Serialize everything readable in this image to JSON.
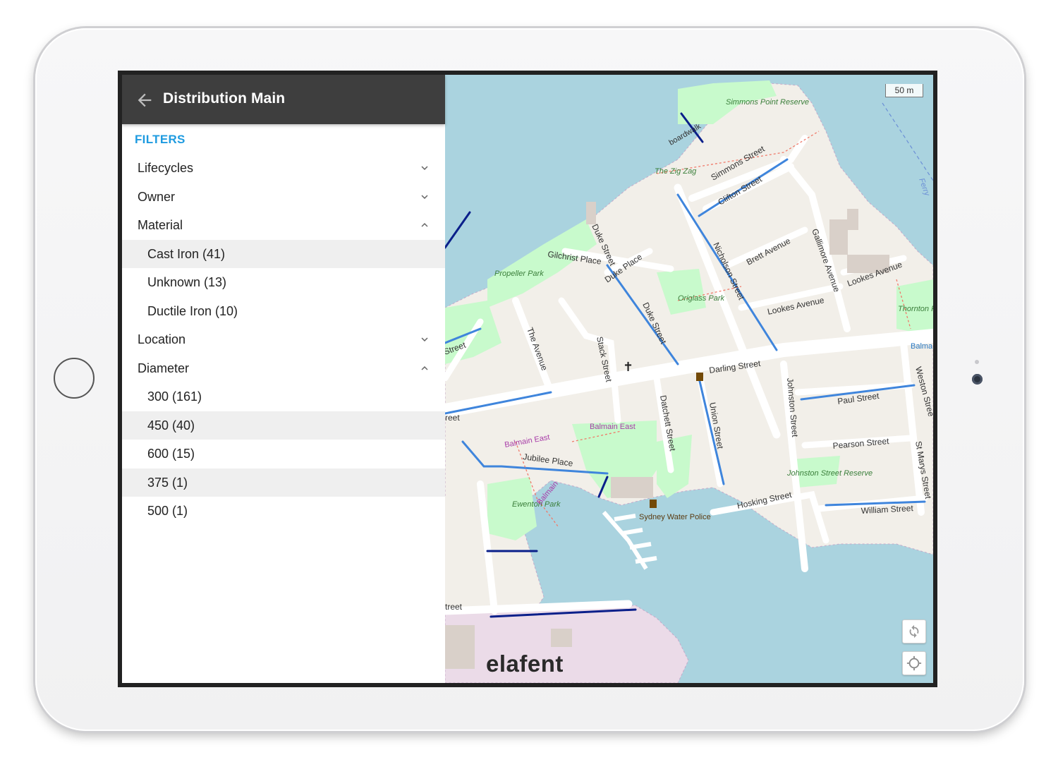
{
  "panel": {
    "title": "Distribution Main",
    "filters_label": "FILTERS",
    "filters": [
      {
        "label": "Lifecycles",
        "expanded": false
      },
      {
        "label": "Owner",
        "expanded": false
      },
      {
        "label": "Material",
        "expanded": true,
        "options": [
          "Cast Iron (41)",
          "Unknown (13)",
          "Ductile Iron (10)"
        ]
      },
      {
        "label": "Location",
        "expanded": false
      },
      {
        "label": "Diameter",
        "expanded": true,
        "options": [
          "300 (161)",
          "450 (40)",
          "600 (15)",
          "375 (1)",
          "500 (1)"
        ]
      }
    ]
  },
  "map": {
    "scale_label": "50 m",
    "logo": "elafent",
    "streets": {
      "darling": "Darling Street",
      "simmons": "Simmons Street",
      "clifton": "Clifton Street",
      "nicholson": "Nicholson Street",
      "brett": "Brett Avenue",
      "gallimore": "Gallimore Avenue",
      "lookes_ave": "Lookes Avenue",
      "lookes_ave2": "Lookes Avenue",
      "duke_street": "Duke Street",
      "duke_street2": "Duke Street",
      "duke_place": "Duke Place",
      "gilchrist": "Gilchrist Place",
      "the_avenue": "The Avenue",
      "stack": "Stack Street",
      "datchett": "Datchett Street",
      "union": "Union Street",
      "johnston": "Johnston Street",
      "paul": "Paul Street",
      "pearson": "Pearson Street",
      "weston": "Weston Stree",
      "st_marys": "St Marys Street",
      "william": "William Street",
      "hosking": "Hosking Street",
      "jubilee": "Jubilee Place",
      "boardwalk": "boardwalk",
      "street_left1": "Street",
      "street_left2": "reet",
      "street_left3": "treet"
    },
    "places": {
      "simmons_reserve": "Simmons Point Reserve",
      "zig_zag": "The Zig Zag",
      "propeller_park": "Propeller Park",
      "origlass_park": "Origlass Park",
      "thornton_park": "Thornton Park",
      "balmain_east_1": "Balmain East",
      "balmain_east_2": "Balmain East",
      "balmain_east_3": "Balma East",
      "balmain_route": "Balmain",
      "eweston_park": "Ewenton Park",
      "johnston_reserve": "Johnston Street Reserve",
      "water_police": "Sydney Water Police",
      "ferry": "Ferry"
    },
    "colors": {
      "water": "#aad3df",
      "land": "#f2efe9",
      "park": "#c8facc",
      "road": "#ffffff",
      "main_light": "#3f85dc",
      "main_dark": "#0a1f8a",
      "accent": "#1e9be0"
    }
  }
}
